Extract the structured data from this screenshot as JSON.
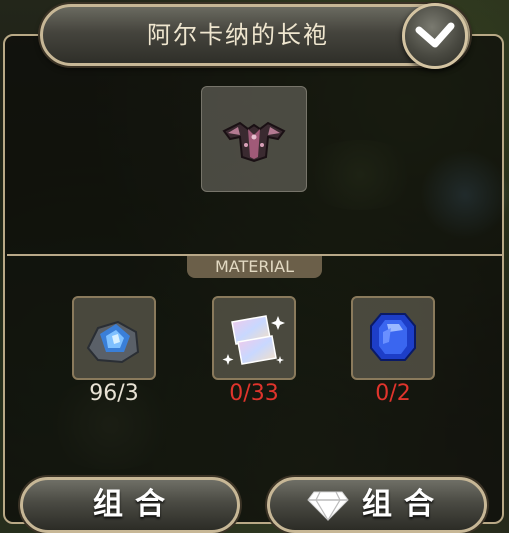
{
  "item": {
    "title": "阿尔卡纳的长袍",
    "icon": "arcana-robe-icon"
  },
  "materials": {
    "section_label": "MATERIAL",
    "items": [
      {
        "icon": "blue-crystal-ore-icon",
        "count": "96/3",
        "count_color": "#e8e2d4"
      },
      {
        "icon": "prismatic-shard-icon",
        "count": "0/33",
        "count_color": "#e0342c"
      },
      {
        "icon": "sapphire-gem-icon",
        "count": "0/2",
        "count_color": "#e0342c"
      }
    ]
  },
  "actions": {
    "combine_label": "组合",
    "gem_combine_label": "组合"
  },
  "colors": {
    "frame": "#c7b796",
    "insufficient": "#e0342c",
    "sufficient": "#e8e2d4"
  }
}
